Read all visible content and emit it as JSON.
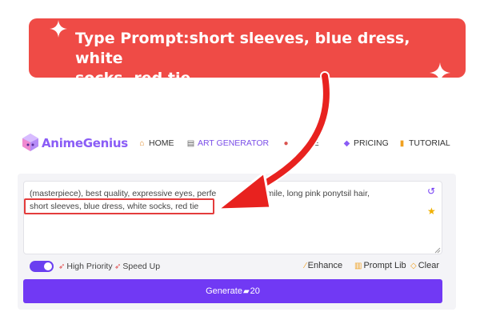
{
  "callout": {
    "line1": "Type Prompt:short sleeves, blue dress, white",
    "line2": "socks, red tie"
  },
  "brand": {
    "name": "AnimeGenius"
  },
  "nav": {
    "items": [
      {
        "label": "HOME",
        "icon": "home-icon"
      },
      {
        "label": "ART GENERATOR",
        "icon": "art-generator-icon"
      },
      {
        "label": "RE",
        "icon": "explore-icon"
      },
      {
        "label": "PRICING",
        "icon": "gem-icon"
      },
      {
        "label": "TUTORIAL",
        "icon": "book-icon"
      }
    ]
  },
  "prompt": {
    "line1": "(masterpiece), best quality, expressive eyes, perfe",
    "line1_tail": "smile, long pink ponytsil hair,",
    "line2": "short sleeves, blue dress, white socks, red tie"
  },
  "controls": {
    "high_priority": "High Priority",
    "speed_up": "Speed Up",
    "enhance": "Enhance",
    "prompt_lib": "Prompt Lib",
    "clear": "Clear"
  },
  "generate": {
    "label": "Generate",
    "cost": "20"
  },
  "colors": {
    "banner": "#ef4b46",
    "accent": "#7139f4",
    "brand": "#8a5cf6",
    "highlight": "#e43c3c"
  }
}
